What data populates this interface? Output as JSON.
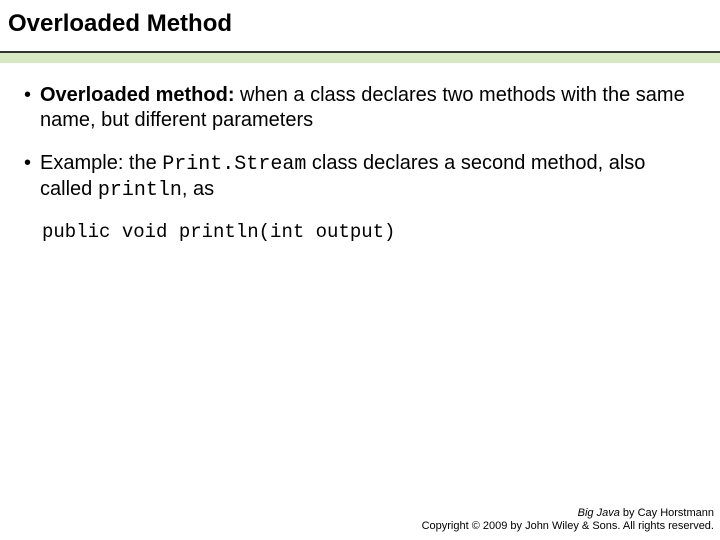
{
  "title": "Overloaded Method",
  "bullets": [
    {
      "strong": "Overloaded method:",
      "rest": " when a class declares two methods with the same name, but different parameters"
    },
    {
      "pre": "Example: the ",
      "code1": "Print.Stream",
      "mid": " class declares a second method, also called ",
      "code2": "println",
      "post": ", as"
    }
  ],
  "code_line": "public void println(int output)",
  "footer": {
    "book": "Big Java",
    "byline": " by Cay Horstmann",
    "copyright": "Copyright © 2009 by John Wiley & Sons. All rights reserved."
  }
}
